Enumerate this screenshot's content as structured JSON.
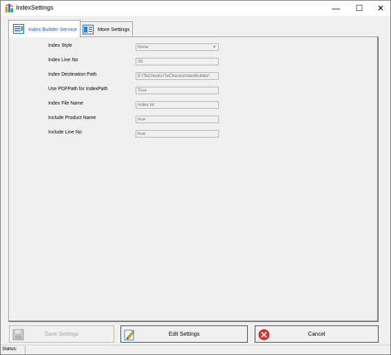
{
  "window": {
    "title": "IndexSettings",
    "controls": {
      "minimize": "—",
      "maximize": "☐",
      "close": "✕"
    }
  },
  "tabs": [
    {
      "label": "Index Builder Service",
      "icon": "index-builder-icon",
      "active": true
    },
    {
      "label": "More Settings",
      "icon": "more-settings-icon",
      "active": false
    }
  ],
  "form": {
    "fields": [
      {
        "label": "Index Style",
        "value": "None",
        "type": "select"
      },
      {
        "label": "Index Line No",
        "value": "25",
        "type": "text"
      },
      {
        "label": "Index Destination Path",
        "value": "E:\\TeChecks\\TeChecksIndexBuilder\\",
        "type": "text"
      },
      {
        "label": "Use PDFPath for IndexPath",
        "value": "True",
        "type": "text"
      },
      {
        "label": "Index File Name",
        "value": "Index.txt",
        "type": "text"
      },
      {
        "label": "Include Product Name",
        "value": "true",
        "type": "text"
      },
      {
        "label": "Include Line No",
        "value": "true",
        "type": "text"
      }
    ]
  },
  "buttons": {
    "save": {
      "label": "Save Settings",
      "icon": "floppy-disk-icon",
      "enabled": false
    },
    "edit": {
      "label": "Edit Settings",
      "icon": "pencil-edit-icon",
      "enabled": true
    },
    "cancel": {
      "label": "Cancel",
      "icon": "red-x-icon",
      "enabled": true
    }
  },
  "status": {
    "label": "Status:",
    "value": ""
  },
  "colors": {
    "active_tab_text": "#1f5fbf",
    "cancel_icon": "#e0322d",
    "field_border": "#b5b5b5",
    "field_text": "#6d6d6d"
  }
}
